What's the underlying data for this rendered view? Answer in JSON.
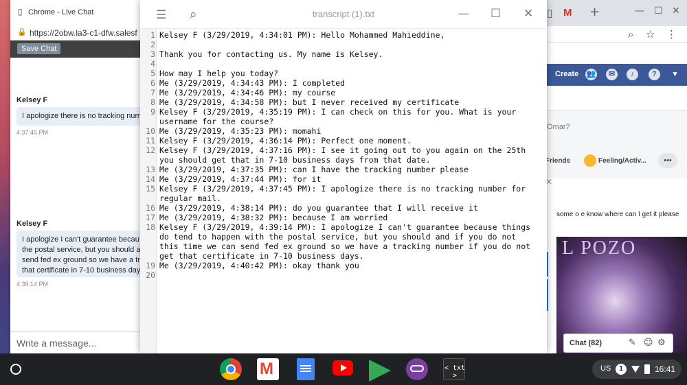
{
  "live_chat": {
    "window_title": "Chrome - Live Chat",
    "url": "https://2obw.la3-c1-dfw.salesf",
    "save_chat_label": "Save Chat",
    "messages": [
      {
        "agent": "Kelsey F",
        "text": "I apologize there is no tracking num",
        "time": "4:37:45 PM"
      },
      {
        "agent": "Kelsey F",
        "text": "I apologize I can't guarantee becau the postal service, but you should a send fed ex ground so we have a tr that certificate in 7-10 business day",
        "time": "4:39:14 PM"
      }
    ],
    "input_placeholder": "Write a message..."
  },
  "editor": {
    "title": "transcript (1).txt",
    "line_numbers": [
      "1",
      "2",
      "3",
      "4",
      "5",
      "6",
      "7",
      "8",
      "9",
      "",
      "10",
      "11",
      "12",
      "",
      "13",
      "14",
      "15",
      "",
      "16",
      "17",
      "18",
      "",
      "",
      "",
      "19",
      "20"
    ],
    "lines": [
      "Kelsey F (3/29/2019, 4:34:01 PM): Hello Mohammed Mahieddine,",
      "",
      "Thank you for contacting us. My name is Kelsey.",
      "",
      "How may I help you today?",
      "Me (3/29/2019, 4:34:43 PM): I completed",
      "Me (3/29/2019, 4:34:46 PM): my course",
      "Me (3/29/2019, 4:34:58 PM): but I never received my certificate",
      "Kelsey F (3/29/2019, 4:35:19 PM): I can check on this for you. What is your",
      "username for the course?",
      "Me (3/29/2019, 4:35:23 PM): momahi",
      "Kelsey F (3/29/2019, 4:36:14 PM): Perfect one moment.",
      "Kelsey F (3/29/2019, 4:37:16 PM): I see it going out to you again on the 25th",
      "you should get that in 7-10 business days from that date.",
      "Me (3/29/2019, 4:37:35 PM): can I have the tracking number please",
      "Me (3/29/2019, 4:37:44 PM): for it",
      "Kelsey F (3/29/2019, 4:37:45 PM): I apologize there is no tracking number for",
      "regular mail.",
      "Me (3/29/2019, 4:38:14 PM): do you guarantee that I will receive it",
      "Me (3/29/2019, 4:38:32 PM): because I am worried",
      "Kelsey F (3/29/2019, 4:39:14 PM): I apologize I can't guarantee because things",
      "do tend to happen with the postal service, but you should and if you do not",
      "this time we can send fed ex ground so we have a tracking number if you do not",
      "get that certificate in 7-10 business days.",
      "Me (3/29/2019, 4:40:42 PM): okay thank you",
      ""
    ]
  },
  "facebook": {
    "create_label": "Create",
    "post_prompt": "Omar?",
    "friends_label": "Friends",
    "feeling_label": "Feeling/Activ...",
    "more_label": "•••",
    "comment_text": "some o e know where can I get it please",
    "photo_text": "L POZO",
    "chat_label": "Chat (82)"
  },
  "shelf": {
    "txt_app_label": "< txt >",
    "language": "US",
    "notification_count": "1",
    "time": "16:41"
  }
}
